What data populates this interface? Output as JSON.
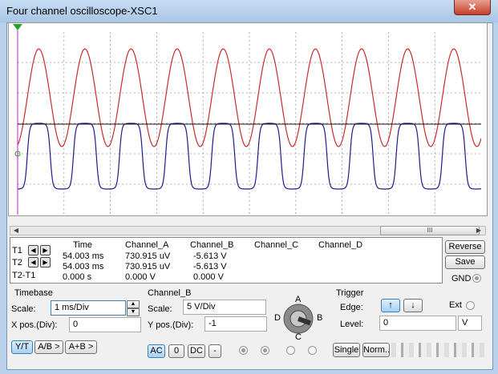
{
  "window": {
    "title": "Four channel oscilloscope-XSC1",
    "close_glyph": "✕"
  },
  "scrollbar": {
    "grip": "III",
    "left_arrow": "◀",
    "right_arrow": "▶"
  },
  "readout": {
    "headers": [
      "Time",
      "Channel_A",
      "Channel_B",
      "Channel_C",
      "Channel_D"
    ],
    "rows": [
      {
        "label": "T1",
        "time": "54.003 ms",
        "a": "730.915 uV",
        "b": "-5.613 V"
      },
      {
        "label": "T2",
        "time": "54.003 ms",
        "a": "730.915 uV",
        "b": "-5.613 V"
      },
      {
        "label": "T2-T1",
        "time": "0.000 s",
        "a": "0.000 V",
        "b": "0.000 V"
      }
    ],
    "arrow_left": "◀",
    "arrow_right": "▶"
  },
  "side_buttons": {
    "reverse": "Reverse",
    "save": "Save",
    "gnd": "GND"
  },
  "timebase": {
    "header": "Timebase",
    "scale_label": "Scale:",
    "scale_value": "1 ms/Div",
    "xpos_label": "X pos.(Div):",
    "xpos_value": "0",
    "buttons": [
      "Y/T",
      "A/B >",
      "A+B >"
    ]
  },
  "channel": {
    "header": "Channel_B",
    "scale_label": "Scale:",
    "scale_value": "5  V/Div",
    "ypos_label": "Y pos.(Div):",
    "ypos_value": "-1",
    "coupling": [
      "AC",
      "0",
      "DC",
      "-"
    ],
    "knob": {
      "a": "A",
      "b": "B",
      "c": "C",
      "d": "D"
    }
  },
  "trigger": {
    "header": "Trigger",
    "edge_label": "Edge:",
    "level_label": "Level:",
    "level_value": "0",
    "level_unit": "V",
    "ext_label": "Ext",
    "rising_glyph": "↑",
    "falling_glyph": "↓",
    "single": "Single",
    "normal": "Norm..."
  },
  "colors": {
    "channel_a": "#cc2a2a",
    "channel_b": "#1c1c8e",
    "baseline": "#111111",
    "cursor": "#c020c0",
    "grid": "#9a9a9a"
  }
}
